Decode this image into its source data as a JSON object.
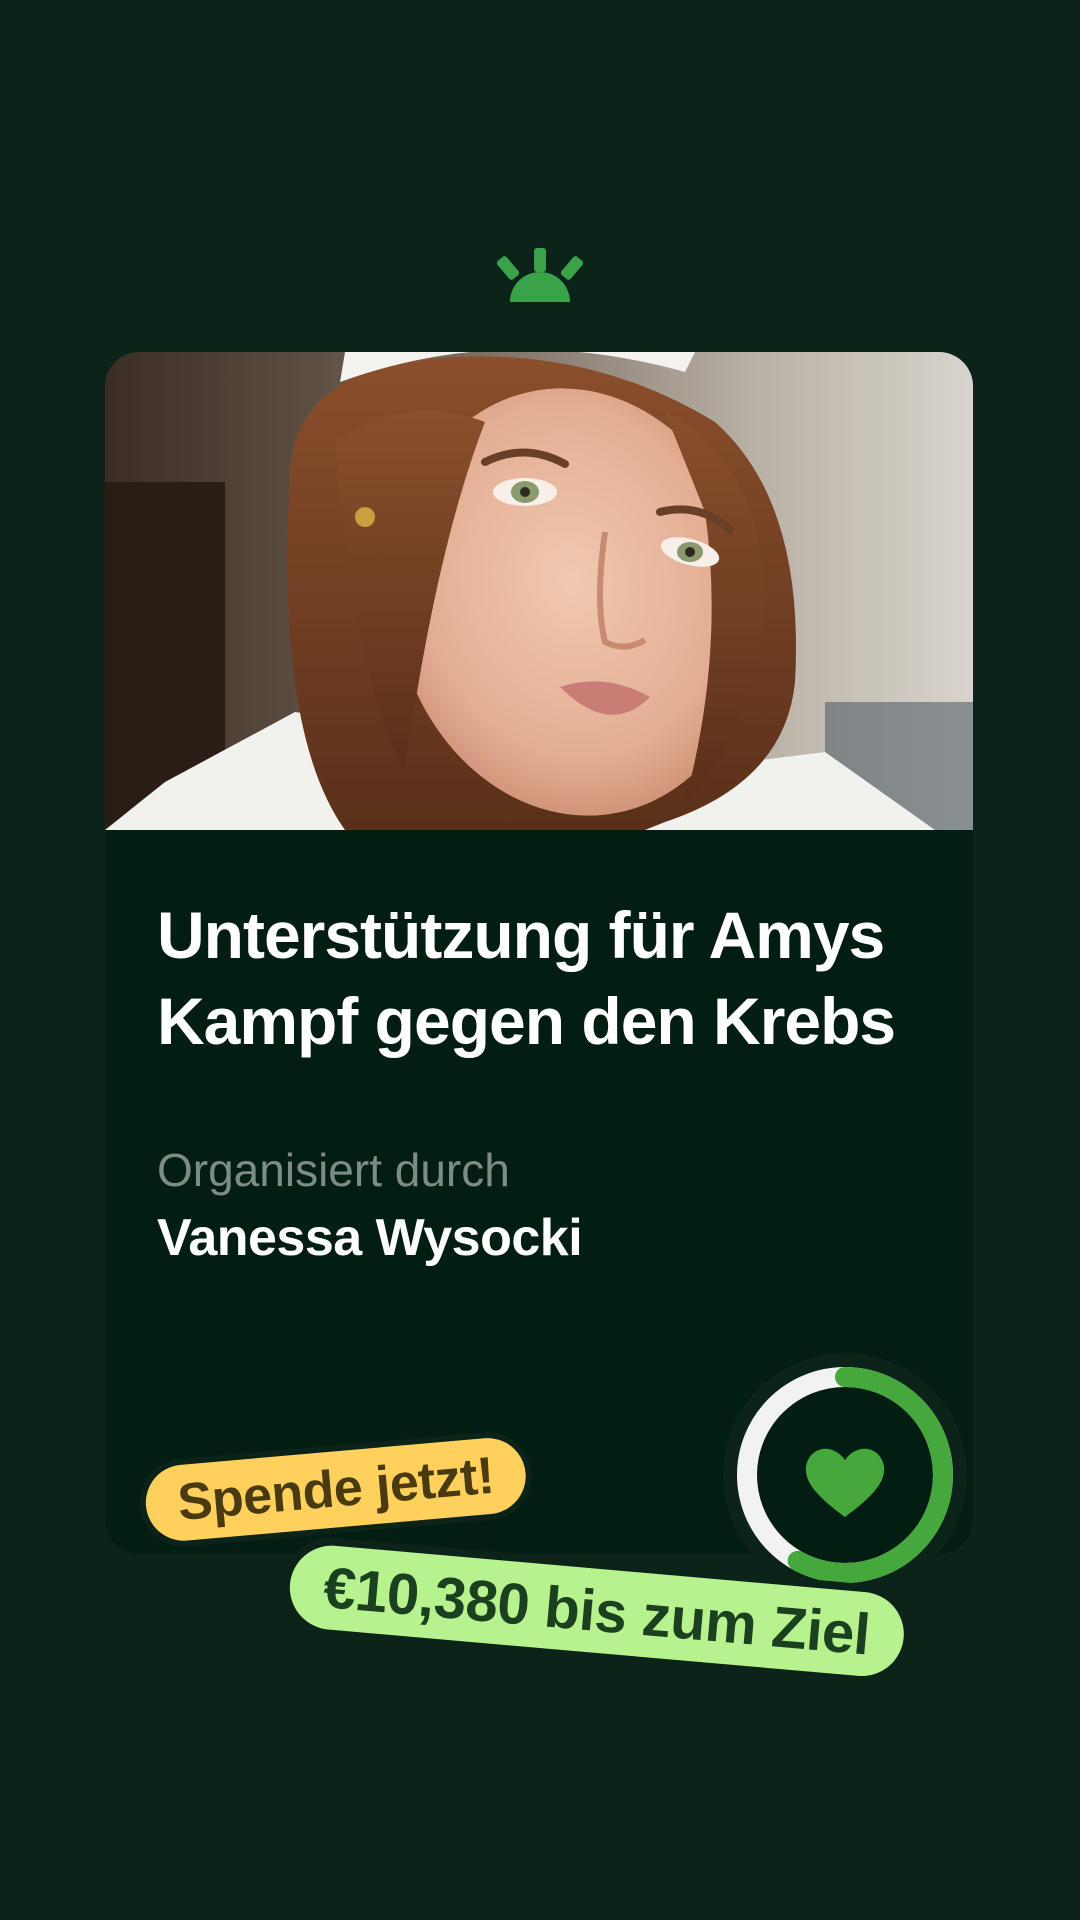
{
  "brand": {
    "logo_icon": "gofundme-sunrise-icon",
    "accent_color": "#3aa34a"
  },
  "campaign": {
    "photo_icon": "campaign-photo",
    "title": "Unterstützung für Amys Kampf gegen den Krebs",
    "organizer_label": "Organisiert durch",
    "organizer_name": "Vanessa Wysocki"
  },
  "progress": {
    "fraction": 0.58,
    "icon": "heart-icon",
    "ring_color": "#45a83c",
    "track_color": "#f2f2f2"
  },
  "cta": {
    "label": "Spende jetzt!",
    "color": "#ffd15c"
  },
  "goal": {
    "label": "€10,380 bis zum Ziel",
    "color": "#b6f28e"
  }
}
